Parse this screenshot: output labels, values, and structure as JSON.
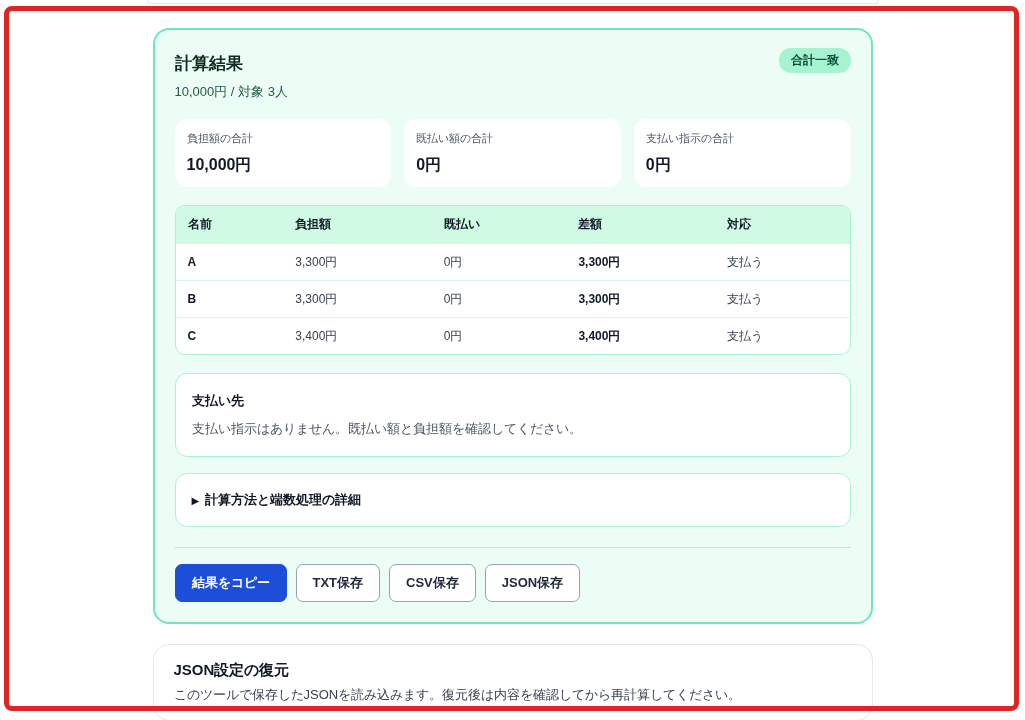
{
  "result": {
    "title": "計算結果",
    "subtitle": "10,000円 / 対象 3人",
    "badge": "合計一致",
    "stats": [
      {
        "label": "負担額の合計",
        "value": "10,000円"
      },
      {
        "label": "既払い額の合計",
        "value": "0円"
      },
      {
        "label": "支払い指示の合計",
        "value": "0円"
      }
    ],
    "table": {
      "columns": [
        {
          "label": "名前",
          "emphasis": true
        },
        {
          "label": "負担額",
          "emphasis": false
        },
        {
          "label": "既払い",
          "emphasis": false
        },
        {
          "label": "差額",
          "emphasis": true
        },
        {
          "label": "対応",
          "emphasis": false
        }
      ],
      "rows": [
        [
          "A",
          "3,300円",
          "0円",
          "3,300円",
          "支払う"
        ],
        [
          "B",
          "3,300円",
          "0円",
          "3,300円",
          "支払う"
        ],
        [
          "C",
          "3,400円",
          "0円",
          "3,400円",
          "支払う"
        ]
      ]
    },
    "payee": {
      "title": "支払い先",
      "text": "支払い指示はありません。既払い額と負担額を確認してください。"
    },
    "details": {
      "marker": "▶",
      "label": "計算方法と端数処理の詳細",
      "expanded": false
    },
    "buttons": [
      {
        "label": "結果をコピー",
        "kind": "primary"
      },
      {
        "label": "TXT保存",
        "kind": "secondary"
      },
      {
        "label": "CSV保存",
        "kind": "secondary"
      },
      {
        "label": "JSON保存",
        "kind": "secondary"
      }
    ]
  },
  "restore": {
    "title": "JSON設定の復元",
    "text": "このツールで保存したJSONを読み込みます。復元後は内容を確認してから再計算してください。"
  }
}
